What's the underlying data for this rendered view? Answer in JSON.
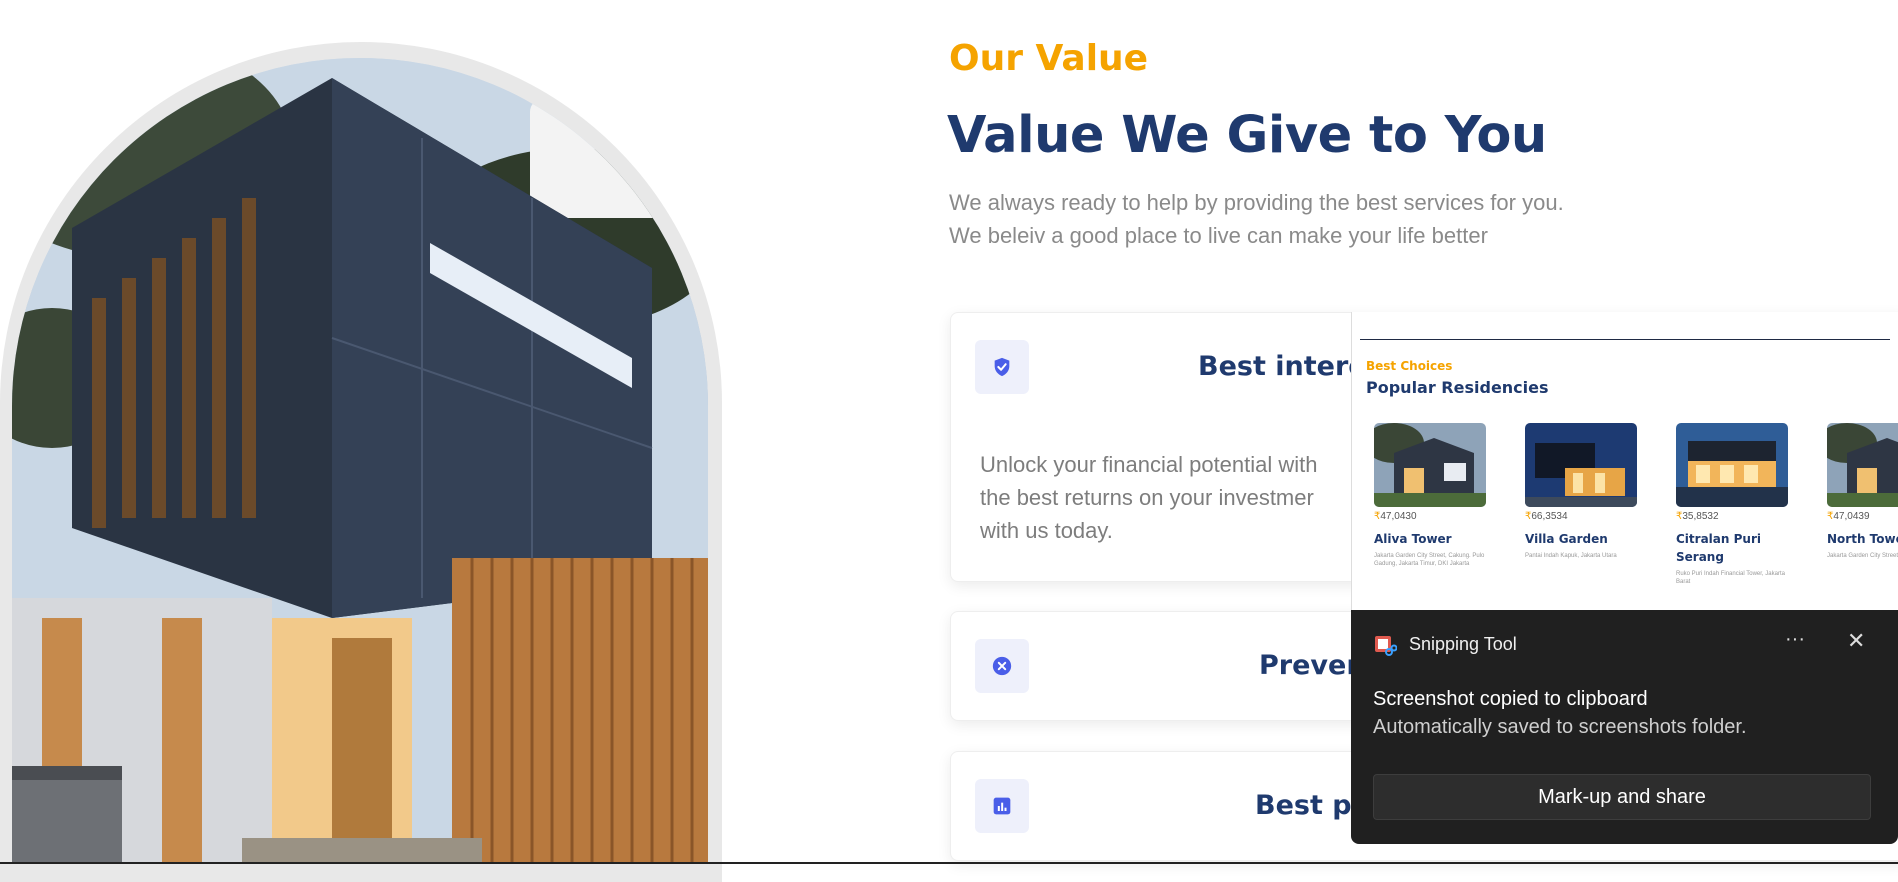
{
  "section": {
    "eyebrow": "Our Value",
    "headline": "Value We Give to You",
    "description_line1": "We always ready to help by providing the best services for you.",
    "description_line2": "We beleiv a good place to live can make your life better"
  },
  "cards": [
    {
      "icon": "shield-check-icon",
      "title": "Best interes",
      "body_line1": "Unlock your financial potential with",
      "body_line2": "the best returns on your investmer",
      "body_line3": "with us today."
    },
    {
      "icon": "x-circle-icon",
      "title": "Preven"
    },
    {
      "icon": "chart-icon",
      "title": "Best pri"
    }
  ],
  "thumbnail": {
    "eyebrow": "Best Choices",
    "title": "Popular Residencies",
    "currency": "₹",
    "items": [
      {
        "price": "47,0430",
        "name": "Aliva Tower",
        "address": "Jakarta Garden City Street, Cakung. Pulo Gadung, Jakarta Timur, DKI Jakarta"
      },
      {
        "price": "66,3534",
        "name": "Villa Garden",
        "address": "Pantai Indah Kapuk, Jakarta Utara"
      },
      {
        "price": "35,8532",
        "name": "Citralan Puri Serang",
        "address": "Ruko Puri Indah Financial Tower, Jakarta Barat"
      },
      {
        "price": "47,0439",
        "name": "North Towe",
        "address": "Jakarta Garden City Street"
      }
    ]
  },
  "toast": {
    "app_name": "Snipping Tool",
    "more_label": "···",
    "close_label": "✕",
    "message": "Screenshot copied to clipboard",
    "detail": "Automatically saved to screenshots folder.",
    "button_label": "Mark-up and share"
  },
  "colors": {
    "accent": "#f5a300",
    "navy": "#1f3a6e",
    "icon_blue": "#4a5ee8",
    "toast_bg": "#202020"
  }
}
